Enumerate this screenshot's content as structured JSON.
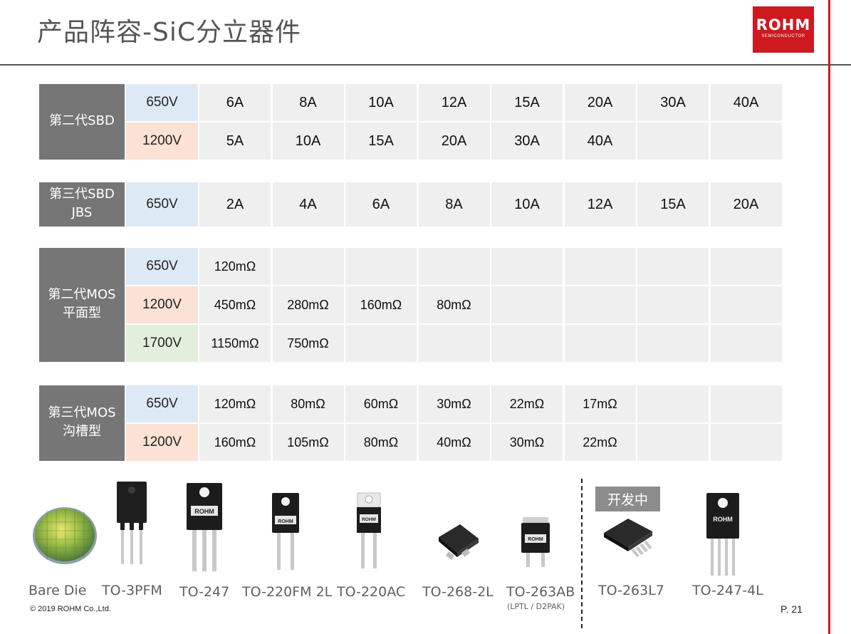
{
  "title": "产品阵容-SiC分立器件",
  "logo": {
    "text": "ROHM",
    "subtitle": "SEMICONDUCTOR"
  },
  "tables": {
    "sbd2": {
      "label": [
        "第二代SBD"
      ],
      "rows": [
        {
          "voltage": "650V",
          "cells": [
            "6A",
            "8A",
            "10A",
            "12A",
            "15A",
            "20A",
            "30A",
            "40A"
          ]
        },
        {
          "voltage": "1200V",
          "cells": [
            "5A",
            "10A",
            "15A",
            "20A",
            "30A",
            "40A",
            "",
            ""
          ]
        }
      ]
    },
    "sbd3": {
      "label": [
        "第三代SBD",
        "JBS"
      ],
      "rows": [
        {
          "voltage": "650V",
          "cells": [
            "2A",
            "4A",
            "6A",
            "8A",
            "10A",
            "12A",
            "15A",
            "20A"
          ]
        }
      ]
    },
    "mos2": {
      "label": [
        "第二代MOS",
        "平面型"
      ],
      "rows": [
        {
          "voltage": "650V",
          "cells": [
            "120mΩ",
            "",
            "",
            "",
            "",
            "",
            "",
            ""
          ]
        },
        {
          "voltage": "1200V",
          "cells": [
            "450mΩ",
            "280mΩ",
            "160mΩ",
            "80mΩ",
            "",
            "",
            "",
            ""
          ]
        },
        {
          "voltage": "1700V",
          "cells": [
            "1150mΩ",
            "750mΩ",
            "",
            "",
            "",
            "",
            "",
            ""
          ]
        }
      ]
    },
    "mos3": {
      "label": [
        "第三代MOS",
        "沟槽型"
      ],
      "rows": [
        {
          "voltage": "650V",
          "cells": [
            "120mΩ",
            "80mΩ",
            "60mΩ",
            "30mΩ",
            "22mΩ",
            "17mΩ",
            "",
            ""
          ]
        },
        {
          "voltage": "1200V",
          "cells": [
            "160mΩ",
            "105mΩ",
            "80mΩ",
            "40mΩ",
            "30mΩ",
            "22mΩ",
            "",
            ""
          ]
        }
      ]
    }
  },
  "colors": {
    "brand_red": "#d0181f",
    "label_gray": "#767676",
    "volt_650": "#ddeaf6",
    "volt_1200": "#fbe2d5",
    "volt_1700": "#e2efda",
    "cell_gray": "#efefef"
  },
  "packages": [
    {
      "name": "Bare Die",
      "icon": "wafer-icon"
    },
    {
      "name": "TO-3PFM",
      "icon": "to3pfm-package-icon"
    },
    {
      "name": "TO-247",
      "icon": "to247-package-icon"
    },
    {
      "name": "TO-220FM 2L",
      "icon": "to220fm-package-icon"
    },
    {
      "name": "TO-220AC",
      "icon": "to220ac-package-icon"
    },
    {
      "name": "TO-268-2L",
      "icon": "to268-package-icon"
    },
    {
      "name": "TO-263AB",
      "sub": "(LPTL / D2PAK)",
      "icon": "to263ab-package-icon"
    },
    {
      "name": "TO-263L7",
      "icon": "to263l7-package-icon"
    },
    {
      "name": "TO-247-4L",
      "icon": "to2474l-package-icon"
    }
  ],
  "package_marking": "ROHM",
  "in_development_label": "开发中",
  "footer": {
    "copyright": "© 2019 ROHM Co.,Ltd.",
    "page": "P. 21"
  }
}
